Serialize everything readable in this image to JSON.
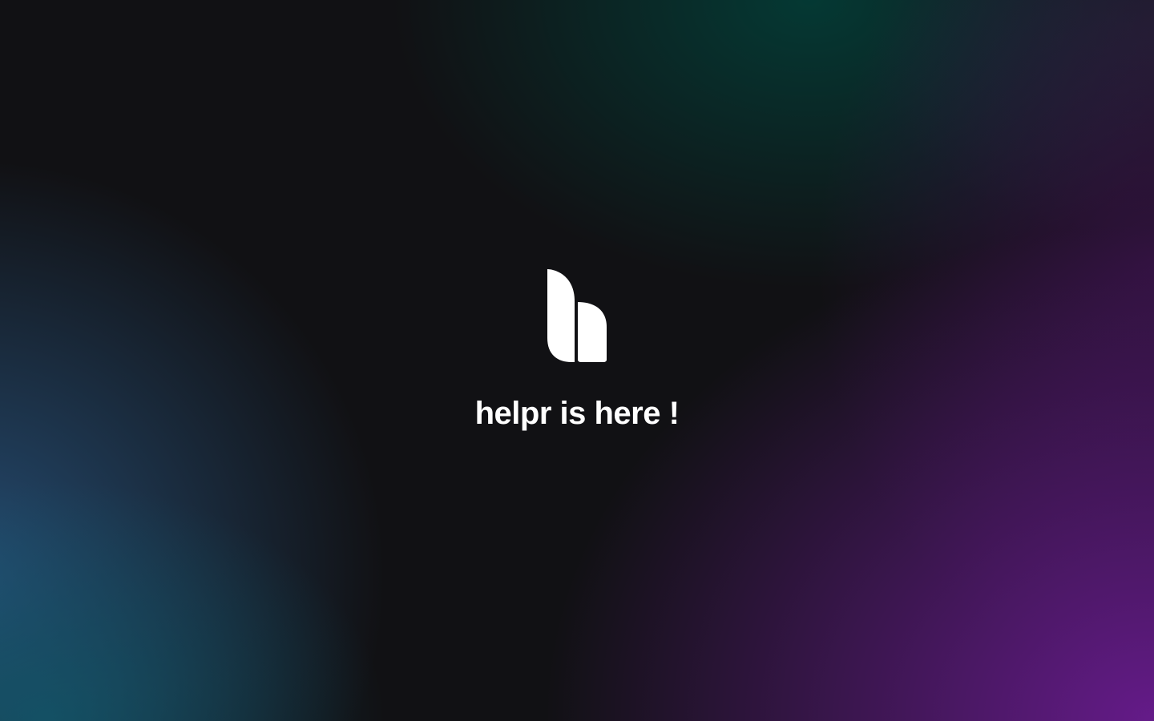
{
  "splash": {
    "logo_icon": "helpr-logo-icon",
    "tagline": "helpr is here !"
  },
  "background": {
    "base_color": "#111114",
    "accent_colors": [
      "#00463e",
      "#285682",
      "#105c6e",
      "#6e1c96"
    ]
  }
}
